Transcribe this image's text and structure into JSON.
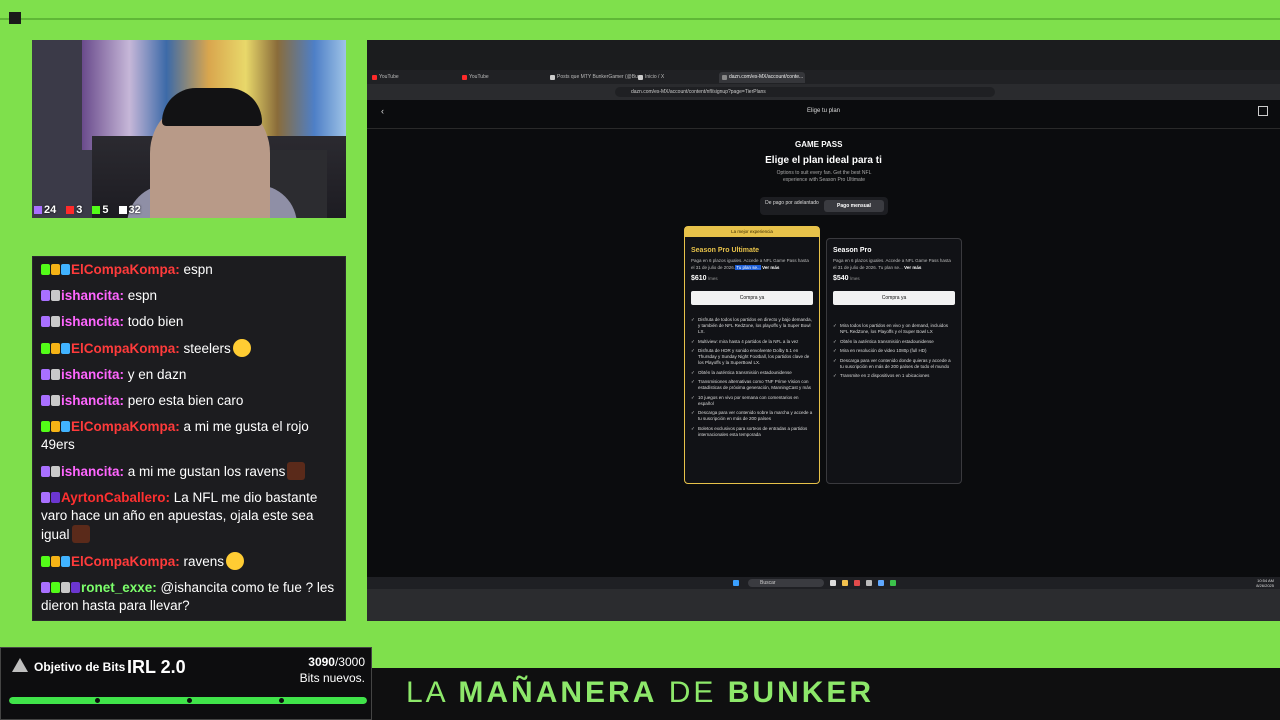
{
  "cam_stats": [
    {
      "icon": "twitch-icon",
      "color": "#a970ff",
      "value": "24"
    },
    {
      "icon": "youtube-icon",
      "color": "#ff2a2a",
      "value": "3"
    },
    {
      "icon": "kick-icon",
      "color": "#53fc18",
      "value": "5"
    },
    {
      "icon": "viewers-icon",
      "color": "#ffffff",
      "value": "32"
    }
  ],
  "chat": [
    {
      "user": "ElCompaKompa:",
      "class": "u-compa",
      "badges": [
        "b-k",
        "b-crown",
        "b-ig"
      ],
      "text": " espn",
      "emoji": ""
    },
    {
      "user": "ishancita:",
      "class": "u-isha",
      "badges": [
        "b-tw",
        "b-shield"
      ],
      "text": " espn",
      "emoji": ""
    },
    {
      "user": "ishancita:",
      "class": "u-isha",
      "badges": [
        "b-tw",
        "b-shield"
      ],
      "text": " todo bien",
      "emoji": ""
    },
    {
      "user": "ElCompaKompa:",
      "class": "u-compa",
      "badges": [
        "b-k",
        "b-crown",
        "b-ig"
      ],
      "text": " steelers",
      "emoji": "laugh"
    },
    {
      "user": "ishancita:",
      "class": "u-isha",
      "badges": [
        "b-tw",
        "b-shield"
      ],
      "text": " y en dazn",
      "emoji": ""
    },
    {
      "user": "ishancita:",
      "class": "u-isha",
      "badges": [
        "b-tw",
        "b-shield"
      ],
      "text": " pero esta bien caro",
      "emoji": ""
    },
    {
      "user": "ElCompaKompa:",
      "class": "u-compa",
      "badges": [
        "b-k",
        "b-crown",
        "b-ig"
      ],
      "text": " a mi me gusta el rojo 49ers",
      "emoji": ""
    },
    {
      "user": "ishancita:",
      "class": "u-isha",
      "badges": [
        "b-tw",
        "b-shield"
      ],
      "text": " a mi me gustan los ravens",
      "emoji": "dark"
    },
    {
      "user": "AyrtonCaballero:",
      "class": "u-ayrton",
      "badges": [
        "b-tw",
        "b-sub"
      ],
      "text": " La NFL me dio bastante varo hace un año en apuestas, ojala este sea igual",
      "emoji": "dark"
    },
    {
      "user": "ElCompaKompa:",
      "class": "u-compa",
      "badges": [
        "b-k",
        "b-crown",
        "b-ig"
      ],
      "text": " ravens",
      "emoji": "laugh"
    },
    {
      "user": "ronet_exxe:",
      "class": "u-ronet",
      "badges": [
        "b-tw",
        "b-k",
        "b-shield",
        "b-sub"
      ],
      "text": " @ishancita como te fue ? les dieron hasta para llevar?",
      "emoji": ""
    }
  ],
  "goal": {
    "title": "Objetivo de Bits",
    "name": "IRL 2.0",
    "current": "3090",
    "target": "/3000",
    "subtitle": "Bits nuevos.",
    "progress_percent": 100
  },
  "banner": {
    "part1": "LA ",
    "part2": "MAÑANERA",
    "part3": " DE ",
    "part4": "BUNKER"
  },
  "browser": {
    "tabs": [
      {
        "label": "YouTube",
        "color": "#ff2a2a",
        "active": false
      },
      {
        "label": "YouTube",
        "color": "#ff2a2a",
        "active": false
      },
      {
        "label": "Posts que MTY BunkerGamer (@Bu...",
        "color": "#cccccc",
        "active": false
      },
      {
        "label": "Inicio / X",
        "color": "#cccccc",
        "active": false
      },
      {
        "label": "dazn.com/es-MX/account/conte...",
        "color": "#888888",
        "active": true
      }
    ],
    "url": "dazn.com/es-MX/account/content/nfl/signup?page=TierPlans"
  },
  "page": {
    "top_title": "Elige tu plan",
    "brand": "GAME PASS",
    "headline": "Elige el plan ideal para ti",
    "subheadline": "Options to suit every fan. Get the best NFL experience with Season Pro Ultimate",
    "toggle_left": "De pago por adelantado",
    "toggle_right": "Pago mensual",
    "plans": [
      {
        "ribbon": "La mejor experiencia",
        "name": "Season Pro Ultimate",
        "desc": "Paga en 6 plazos iguales. Accede a NFL Game Pass hasta el 31 de julio de 2026.",
        "desc_hl": " Tu plan se...",
        "more": " Ver más",
        "price": "$610",
        "per": " /mes",
        "buy": "Compra ya",
        "features": [
          "Disfruta de todos los partidos en directo y bajo demanda, y también de NFL RedZone, los playoffs y la Super Bowl LX.",
          "Multiview: mira hasta 4 partidos de la NFL a la vez",
          "Disfruta de HDR y sonido envolvente Dolby 5.1 en Thursday y Sunday Night Football, los partidos clave de los Playoffs y la SuperBowl LX.",
          "Obtén la auténtica transmisión estadounidense",
          "Transmisiones alternativas como TNF Prime Vision con estadísticas de próxima generación, ManningCast y más",
          "10 juegos en vivo por semana con comentarios en español",
          "Descarga para ver contenido sobre la marcha y accede a tu suscripción en más de 200 países",
          "Boletos exclusivos para sorteos de entradas a partidos internacionales esta temporada"
        ]
      },
      {
        "ribbon": "",
        "name": "Season Pro",
        "desc": "Paga en 6 plazos iguales. Accede a NFL Game Pass hasta el 31 de julio de 2026. Tu plan se...",
        "desc_hl": "",
        "more": " Ver más",
        "price": "$540",
        "per": " /mes",
        "buy": "Compra ya",
        "features": [
          "Mira todos los partidos en vivo y on demand, incluidos NFL RedZone, los Playoffs y el Super Bowl LX",
          "Obtén la auténtica transmisión estadounidense",
          "Mira en resolución de video 1080p (full HD)",
          "Descarga para ver contenido donde quieras y accede a tu suscripción en más de 200 países de todo el mundo",
          "Transmite en 2 dispositivos en 1 ubicaciones"
        ]
      }
    ]
  },
  "taskbar": {
    "search": "Buscar",
    "time": "10:54 AM",
    "date": "8/26/2025"
  }
}
